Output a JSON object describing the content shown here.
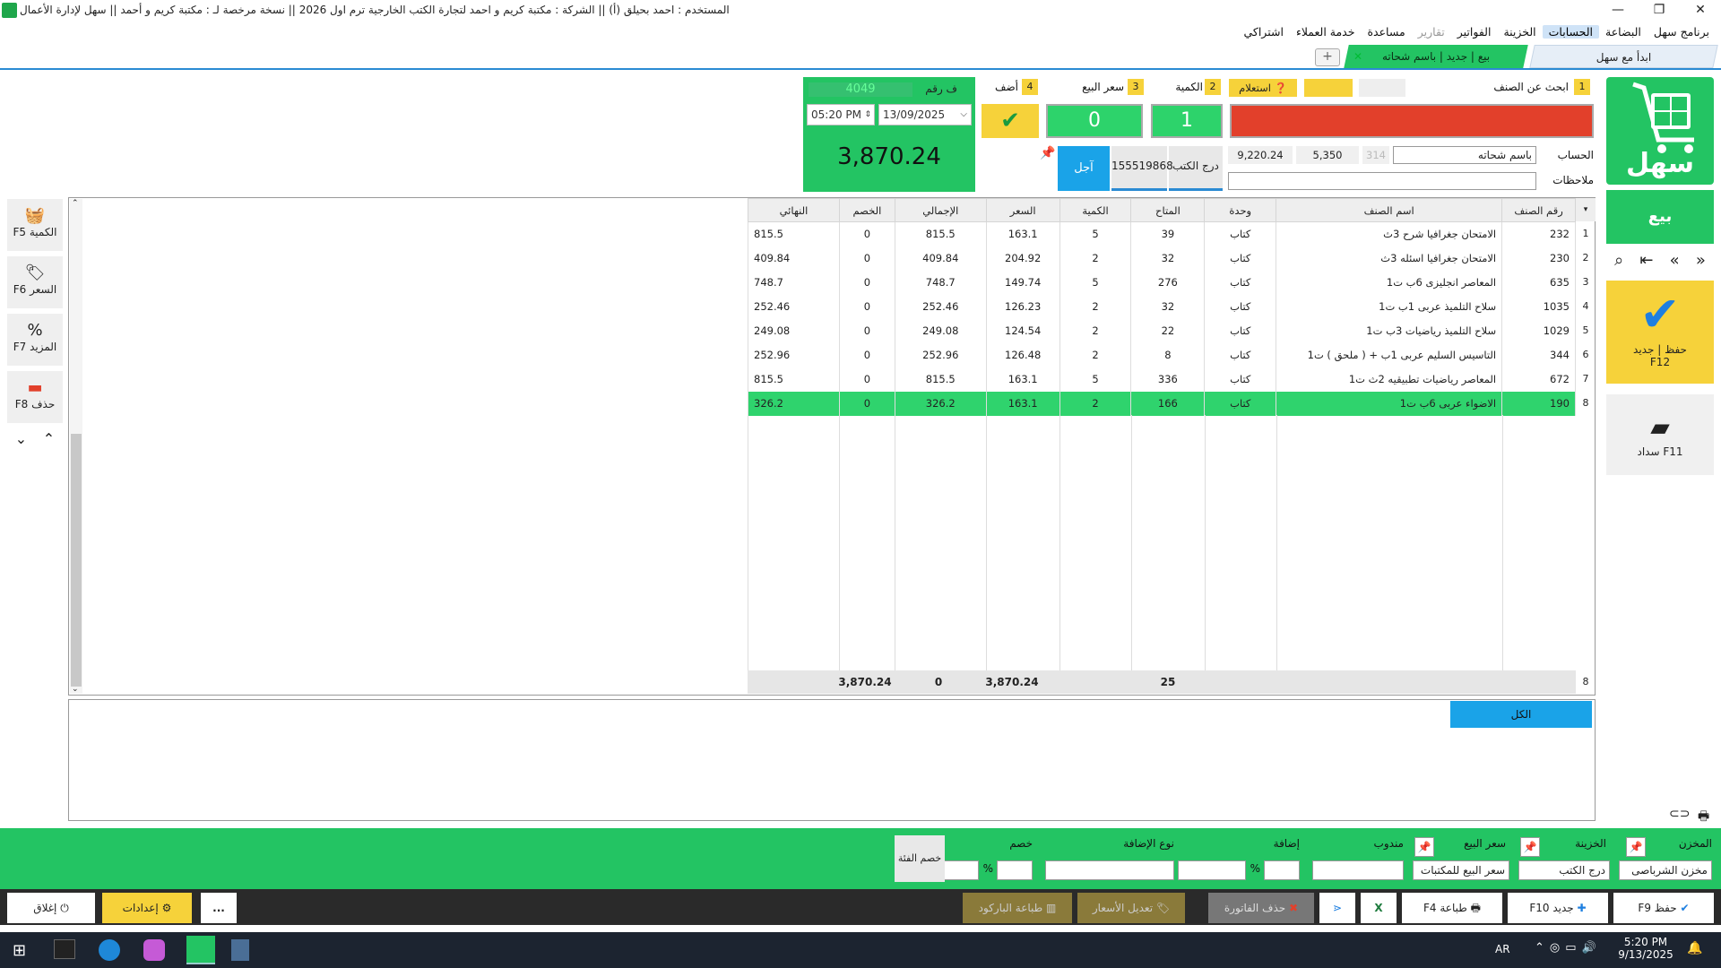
{
  "title_bar": {
    "app_title": "سهل لإدارة الأعمال",
    "license": "نسخة مرخصة لـ : مكتبة كريم و أحمد",
    "company": "الشركة : مكتبة كريم و احمد لتجارة الكتب الخارجية ترم اول 2026",
    "user": "المستخدم : احمد بحيلق (أ)",
    "sep": "||"
  },
  "menu": [
    {
      "label": "برنامج سهل"
    },
    {
      "label": "البضاعة"
    },
    {
      "label": "الحسابات"
    },
    {
      "label": "الخزينة"
    },
    {
      "label": "الفواتير"
    },
    {
      "label": "تقارير"
    },
    {
      "label": "مساعدة"
    },
    {
      "label": "خدمة العملاء"
    },
    {
      "label": "اشتراكي"
    }
  ],
  "tabs": {
    "home": "ابدأ مع سهل",
    "sale": "بيع | جديد | باسم شحاته"
  },
  "rail": {
    "logo_text": "سهل",
    "sell": "بيع",
    "save_label": "حفظ | جديد",
    "save_key": "F12",
    "pay_label": "سداد F11"
  },
  "entry": {
    "step1": "1",
    "search_label": "ابحث عن الصنف",
    "step2": "2",
    "qty_label": "الكمية",
    "step3": "3",
    "price_label": "سعر البيع",
    "step4": "4",
    "add_label": "أضف",
    "inquiry": "استعلام",
    "qty_value": "1",
    "price_value": "0",
    "account_label": "الحساب",
    "account_value": "باسم شحاته",
    "notes_label": "ملاحظات",
    "val_a": "314",
    "val_b": "5,350",
    "val_c": "9,220.24",
    "drawer": "درج الكتب",
    "code": "155519868",
    "credit": "آجل"
  },
  "invoice": {
    "label": "ف رقم",
    "number": "4049",
    "time": "05:20 PM",
    "date": "13/09/2025",
    "total": "3,870.24"
  },
  "tools": [
    {
      "label": "الكمية F5",
      "icon": "basket-icon"
    },
    {
      "label": "السعر F6",
      "icon": "tag-icon"
    },
    {
      "label": "المزيد F7",
      "icon": "percent-icon"
    },
    {
      "label": "حذف F8",
      "icon": "minus-icon"
    }
  ],
  "grid": {
    "headers": [
      "رقم الصنف",
      "اسم الصنف",
      "وحدة",
      "المتاح",
      "الكمية",
      "السعر",
      "الإجمالي",
      "الخصم",
      "النهائي"
    ],
    "rows": [
      [
        "232",
        "الامتحان جغرافيا شرح 3ث",
        "كتاب",
        "39",
        "5",
        "163.1",
        "815.5",
        "0",
        "815.5"
      ],
      [
        "230",
        "الامتحان جغرافيا اسئله 3ث",
        "كتاب",
        "32",
        "2",
        "204.92",
        "409.84",
        "0",
        "409.84"
      ],
      [
        "635",
        "المعاصر انجليزى 6ب ت1",
        "كتاب",
        "276",
        "5",
        "149.74",
        "748.7",
        "0",
        "748.7"
      ],
      [
        "1035",
        "سلاح التلميذ عربى 1ب ت1",
        "كتاب",
        "32",
        "2",
        "126.23",
        "252.46",
        "0",
        "252.46"
      ],
      [
        "1029",
        "سلاح التلميذ رياضيات 3ب ت1",
        "كتاب",
        "22",
        "2",
        "124.54",
        "249.08",
        "0",
        "249.08"
      ],
      [
        "344",
        "التاسيس السليم عربى 1ب + ( ملحق ) ت1",
        "كتاب",
        "8",
        "2",
        "126.48",
        "252.96",
        "0",
        "252.96"
      ],
      [
        "672",
        "المعاصر رياضيات تطبيقيه 2ث ت1",
        "كتاب",
        "336",
        "5",
        "163.1",
        "815.5",
        "0",
        "815.5"
      ],
      [
        "190",
        "الاضواء عربى 6ب ت1",
        "كتاب",
        "166",
        "2",
        "163.1",
        "326.2",
        "0",
        "326.2"
      ]
    ],
    "row_numbers": [
      "1",
      "2",
      "3",
      "4",
      "5",
      "6",
      "7",
      "8"
    ],
    "summary": {
      "count": "8",
      "qty": "25",
      "total": "3,870.24",
      "discount": "0",
      "final": "3,870.24"
    }
  },
  "lower": {
    "all": "الكل"
  },
  "footer": {
    "store_label": "المخزن",
    "store_value": "مخزن الشرباصى",
    "treasury_label": "الخزينة",
    "treasury_value": "درج الكتب",
    "price_label": "سعر البيع",
    "price_value": "سعر البيع للمكتبات",
    "rep_label": "مندوب",
    "add_label": "إضافة",
    "add_type_label": "نوع الإضافة",
    "discount_label": "خصم",
    "pct": "%",
    "group_discount": "خصم الفئة"
  },
  "actions": {
    "save": "حفظ F9",
    "new": "جديد F10",
    "print": "طباعة F4",
    "delete_invoice": "حذف الفاتورة",
    "edit_prices": "تعديل الأسعار",
    "print_barcode": "طباعة الباركود",
    "more": "...",
    "settings": "إعدادات",
    "close": "إغلاق"
  },
  "taskbar": {
    "lang": "AR",
    "time": "5:20 PM",
    "date": "9/13/2025"
  },
  "colors": {
    "green": "#23c463",
    "yellow": "#f6d23a",
    "red": "#e2402b",
    "blue": "#1aa3e8"
  }
}
